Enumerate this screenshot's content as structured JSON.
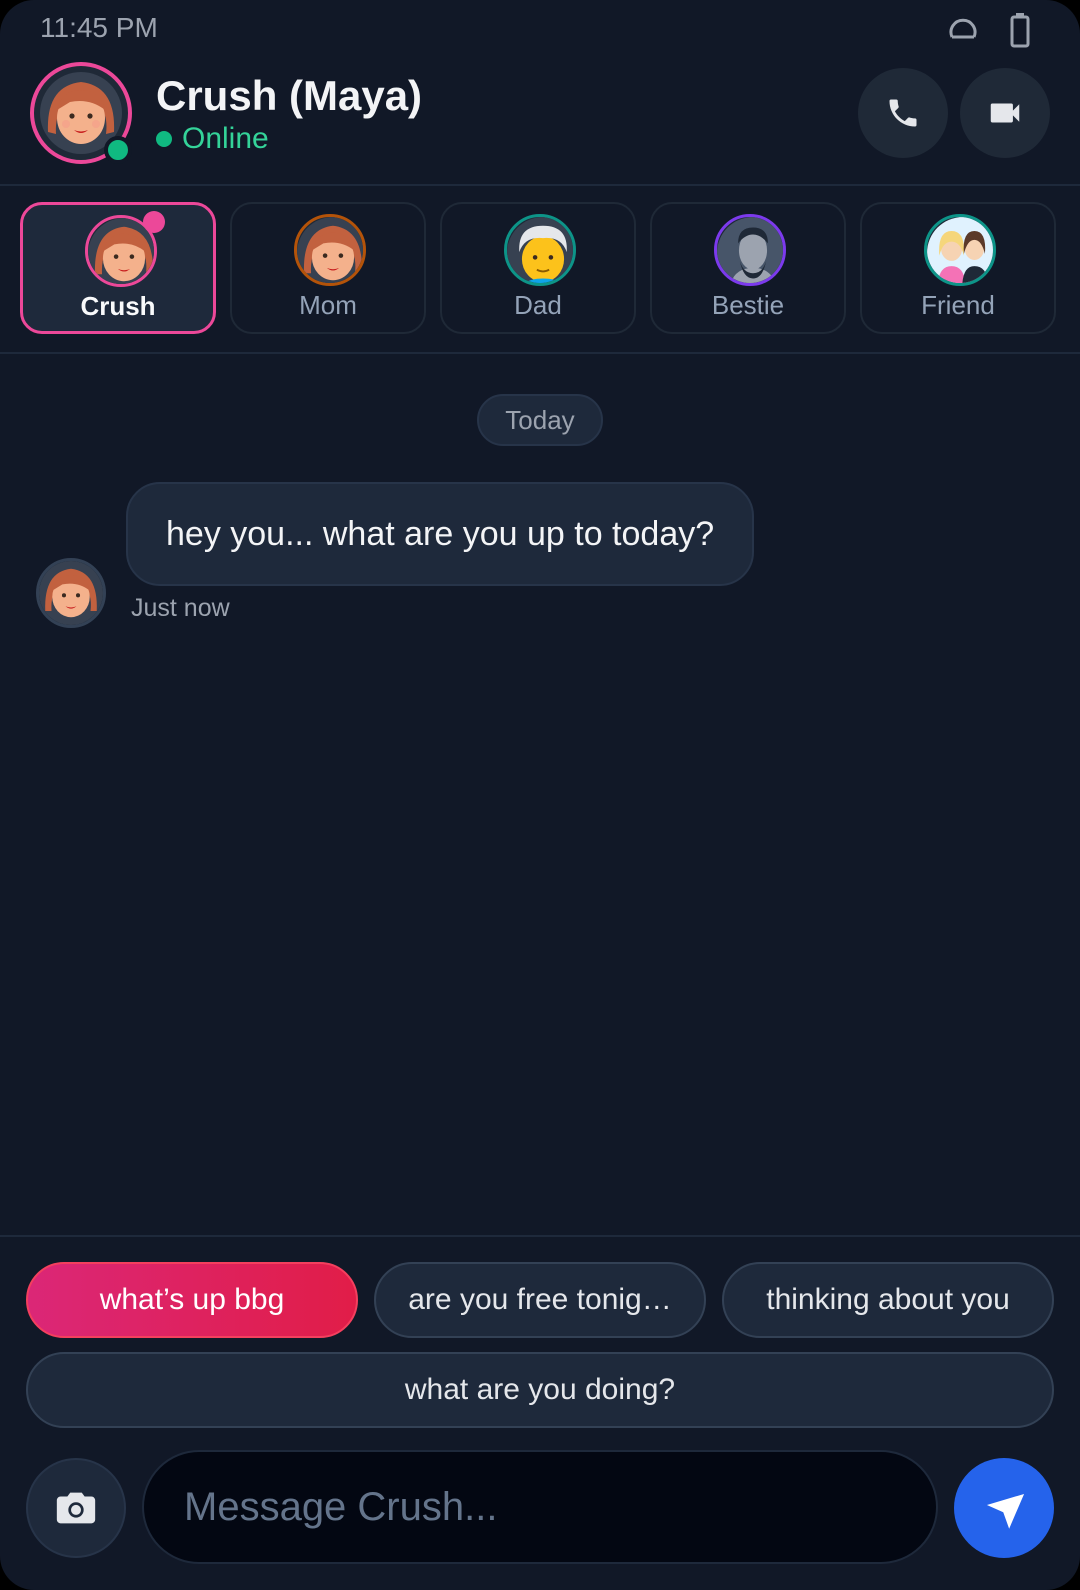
{
  "status_bar": {
    "time": "11:45 PM",
    "icons": [
      "signal-icon",
      "battery-icon"
    ]
  },
  "header": {
    "name": "Crush (Maya)",
    "status": "Online",
    "avatar": "woman-face-avatar",
    "actions": [
      {
        "name": "voice-call-button",
        "icon": "phone-icon"
      },
      {
        "name": "video-call-button",
        "icon": "video-camera-icon"
      }
    ]
  },
  "contacts": [
    {
      "label": "Crush",
      "active": true,
      "unread": true,
      "avatar": "woman-face"
    },
    {
      "label": "Mom",
      "active": false,
      "avatar": "woman-face"
    },
    {
      "label": "Dad",
      "active": false,
      "avatar": "old-man-face"
    },
    {
      "label": "Bestie",
      "active": false,
      "avatar": "silhouette-face"
    },
    {
      "label": "Friend",
      "active": false,
      "avatar": "bff-girls"
    }
  ],
  "chat": {
    "date_label": "Today",
    "messages": [
      {
        "text": "hey you... what are you up to today?",
        "time": "Just now",
        "from": "Crush"
      }
    ]
  },
  "suggestions": [
    "what’s up bbg",
    "are you free tonig…",
    "thinking about you",
    "what are you doing?"
  ],
  "composer": {
    "placeholder": "Message Crush..."
  },
  "colors": {
    "background": "#111827",
    "accent_pink": "#ec4899",
    "online_green": "#10b981",
    "send_blue": "#2563eb"
  }
}
